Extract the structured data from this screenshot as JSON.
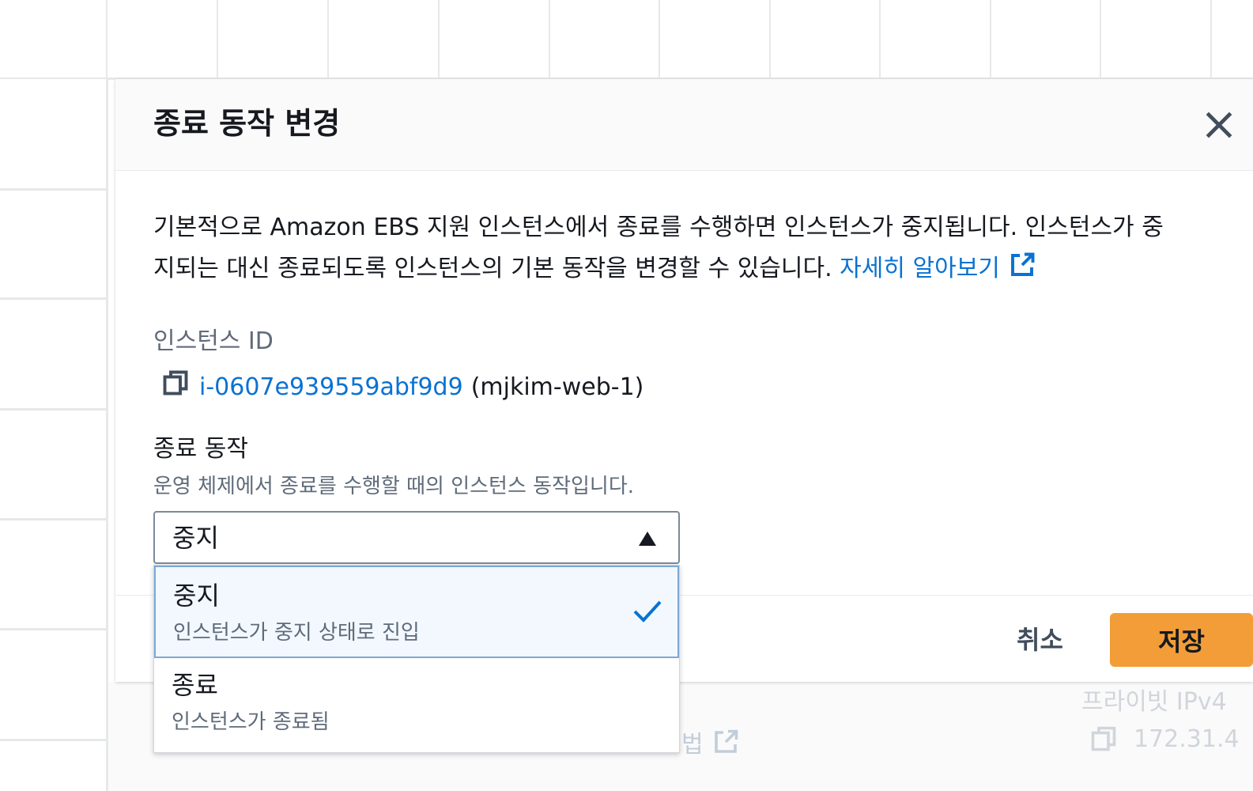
{
  "modal": {
    "title": "종료 동작 변경",
    "description_line1": "기본적으로 Amazon EBS 지원 인스턴스에서 종료를 수행하면 인스턴스가 중지됩니다. 인스턴스가 중",
    "description_line2": "지되는 대신 종료되도록 인스턴스의 기본 동작을 변경할 수 있습니다.",
    "learn_more_label": "자세히 알아보기",
    "instance_id_label": "인스턴스 ID",
    "instance_id": "i-0607e939559abf9d9",
    "instance_name": "(mjkim-web-1)",
    "shutdown_behavior_label": "종료 동작",
    "shutdown_behavior_desc": "운영 체제에서 종료를 수행할 때의 인스턴스 동작입니다.",
    "select": {
      "value": "중지",
      "options": [
        {
          "title": "중지",
          "desc": "인스턴스가 중지 상태로 진입",
          "selected": true
        },
        {
          "title": "종료",
          "desc": "인스턴스가 종료됨",
          "selected": false
        }
      ]
    },
    "footer": {
      "cancel_label": "취소",
      "save_label": "저장"
    }
  },
  "background": {
    "link_fragment": "법",
    "private_ipv4_label": "프라이빗 IPv4",
    "private_ip_fragment": "172.31.4"
  },
  "colors": {
    "link": "#0972d3",
    "save_button": "#f29d38",
    "selected_option_bg": "#f2f8fd"
  },
  "icons": [
    "close-icon",
    "external-link-icon",
    "copy-icon",
    "caret-up-icon",
    "checkmark-icon"
  ]
}
